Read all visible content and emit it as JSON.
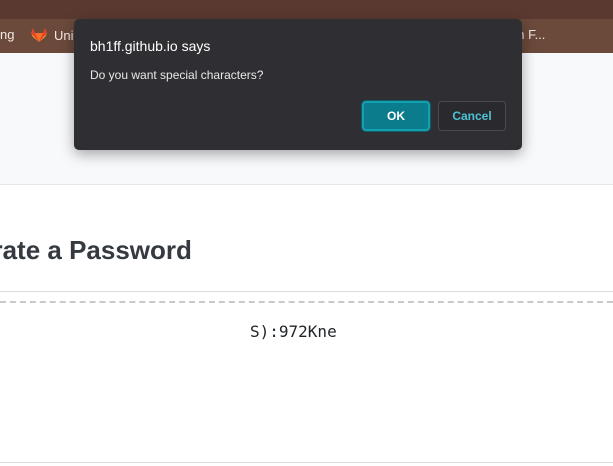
{
  "bookmarks": {
    "item1_label": "ng",
    "item2_label": "Uni",
    "item3_label": "on F..."
  },
  "page": {
    "title": "erate a Password",
    "password": "S):972Kne"
  },
  "dialog": {
    "title": "bh1ff.github.io says",
    "message": "Do you want special characters?",
    "ok_label": "OK",
    "cancel_label": "Cancel"
  },
  "colors": {
    "bookmarks_bar": "#6b4a3c",
    "dialog_bg": "#2f2f33",
    "ok_button": "#0b7c8c",
    "cancel_text": "#4cc3d6"
  }
}
